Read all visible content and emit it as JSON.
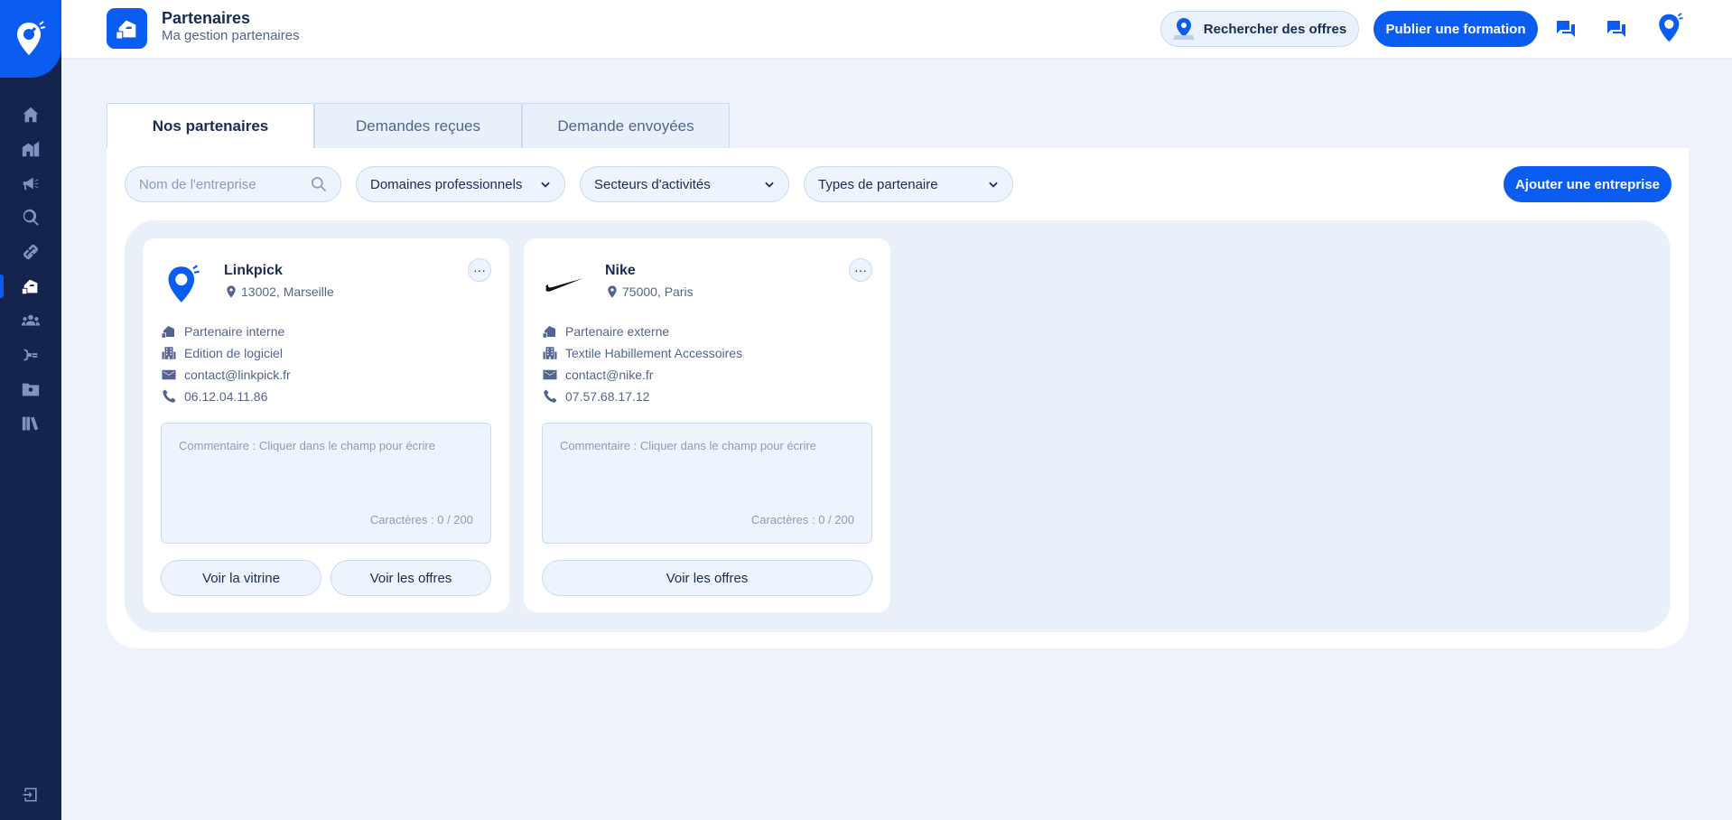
{
  "header": {
    "title": "Partenaires",
    "subtitle": "Ma gestion partenaires",
    "search_offers_label": "Rechercher des offres",
    "publish_label": "Publier une formation"
  },
  "sidebar": {
    "items": [
      {
        "icon": "home-icon"
      },
      {
        "icon": "buildings-icon"
      },
      {
        "icon": "megaphone-icon"
      },
      {
        "icon": "search-globe-icon"
      },
      {
        "icon": "link-icon"
      },
      {
        "icon": "partners-icon",
        "active": true
      },
      {
        "icon": "group-icon"
      },
      {
        "icon": "plug-icon"
      },
      {
        "icon": "contact-folder-icon"
      },
      {
        "icon": "books-icon"
      }
    ],
    "logout_icon": "logout-icon"
  },
  "tabs": [
    {
      "label": "Nos partenaires",
      "active": true
    },
    {
      "label": "Demandes reçues",
      "active": false
    },
    {
      "label": "Demande envoyées",
      "active": false
    }
  ],
  "filters": {
    "company_placeholder": "Nom de l'entreprise",
    "domains_label": "Domaines professionnels",
    "sectors_label": "Secteurs d'activités",
    "types_label": "Types de partenaire",
    "add_label": "Ajouter une entreprise"
  },
  "cards": [
    {
      "name": "Linkpick",
      "location": "13002, Marseille",
      "partner_type": "Partenaire interne",
      "sector": "Edition de logiciel",
      "email": "contact@linkpick.fr",
      "phone": "06.12.04.11.86",
      "comment_placeholder": "Commentaire : Cliquer dans le champ pour écrire",
      "char_count": "Caractères : 0 / 200",
      "btn_vitrine": "Voir la vitrine",
      "btn_offres": "Voir les offres"
    },
    {
      "name": "Nike",
      "location": "75000, Paris",
      "partner_type": "Partenaire externe",
      "sector": "Textile Habillement Accessoires",
      "email": "contact@nike.fr",
      "phone": "07.57.68.17.12",
      "comment_placeholder": "Commentaire : Cliquer dans le champ pour écrire",
      "char_count": "Caractères : 0 / 200",
      "btn_offres": "Voir les offres"
    }
  ],
  "colors": {
    "primary": "#0b5cf0",
    "sidebar": "#14244f",
    "background": "#eef3fb",
    "text": "#1a2b55",
    "muted": "#52648f",
    "border": "#c9d9f2"
  }
}
